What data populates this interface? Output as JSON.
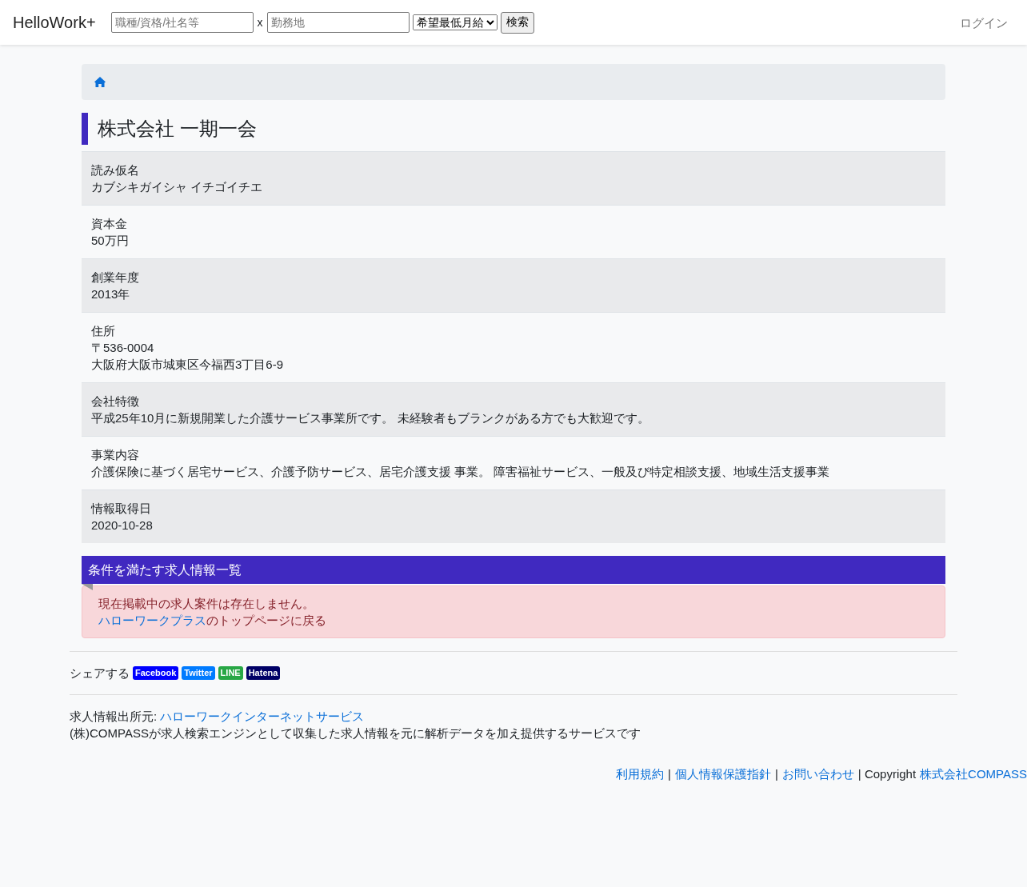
{
  "header": {
    "brand": "HelloWork+",
    "keyword": {
      "placeholder": "職種/資格/社名等"
    },
    "joiner": "x",
    "location": {
      "placeholder": "勤務地"
    },
    "salary_select": "希望最低月給",
    "search_button": "検索",
    "login": "ログイン"
  },
  "title": "株式会社 一期一会",
  "details": [
    {
      "label": "読み仮名",
      "lines": [
        "カブシキガイシャ イチゴイチエ"
      ]
    },
    {
      "label": "資本金",
      "lines": [
        "50万円"
      ]
    },
    {
      "label": "創業年度",
      "lines": [
        "2013年"
      ]
    },
    {
      "label": "住所",
      "lines": [
        "〒536-0004",
        "大阪府大阪市城東区今福西3丁目6-9"
      ]
    },
    {
      "label": "会社特徴",
      "lines": [
        "平成25年10月に新規開業した介護サービス事業所です。 未経験者もブランクがある方でも大歓迎です。"
      ]
    },
    {
      "label": "事業内容",
      "lines": [
        "介護保険に基づく居宅サービス、介護予防サービス、居宅介護支援 事業。 障害福祉サービス、一般及び特定相談支援、地域生活支援事業"
      ]
    },
    {
      "label": "情報取得日",
      "lines": [
        "2020-10-28"
      ]
    }
  ],
  "jobs": {
    "heading": "条件を満たす求人情報一覧",
    "message": "現在掲載中の求人案件は存在しません。",
    "link": "ハローワークプラス",
    "link_suffix": "のトップページに戻る"
  },
  "share": {
    "label": "シェアする",
    "buttons": [
      {
        "label": "Facebook",
        "color": "#0000ff"
      },
      {
        "label": "Twitter",
        "color": "#007bff"
      },
      {
        "label": "LINE",
        "color": "#28a745"
      },
      {
        "label": "Hatena",
        "color": "#000066"
      }
    ]
  },
  "source": {
    "label": "求人情報出所元:",
    "link": "ハローワークインターネットサービス",
    "note": "(株)COMPASSが求人検索エンジンとして収集した求人情報を元に解析データを加え提供するサービスです"
  },
  "footer": [
    {
      "kind": "link",
      "text": "利用規約"
    },
    {
      "kind": "text",
      "text": "|"
    },
    {
      "kind": "link",
      "text": "個人情報保護指針"
    },
    {
      "kind": "text",
      "text": "|"
    },
    {
      "kind": "link",
      "text": "お問い合わせ"
    },
    {
      "kind": "text",
      "text": "| Copyright"
    },
    {
      "kind": "link",
      "text": "株式会社COMPASS"
    }
  ]
}
